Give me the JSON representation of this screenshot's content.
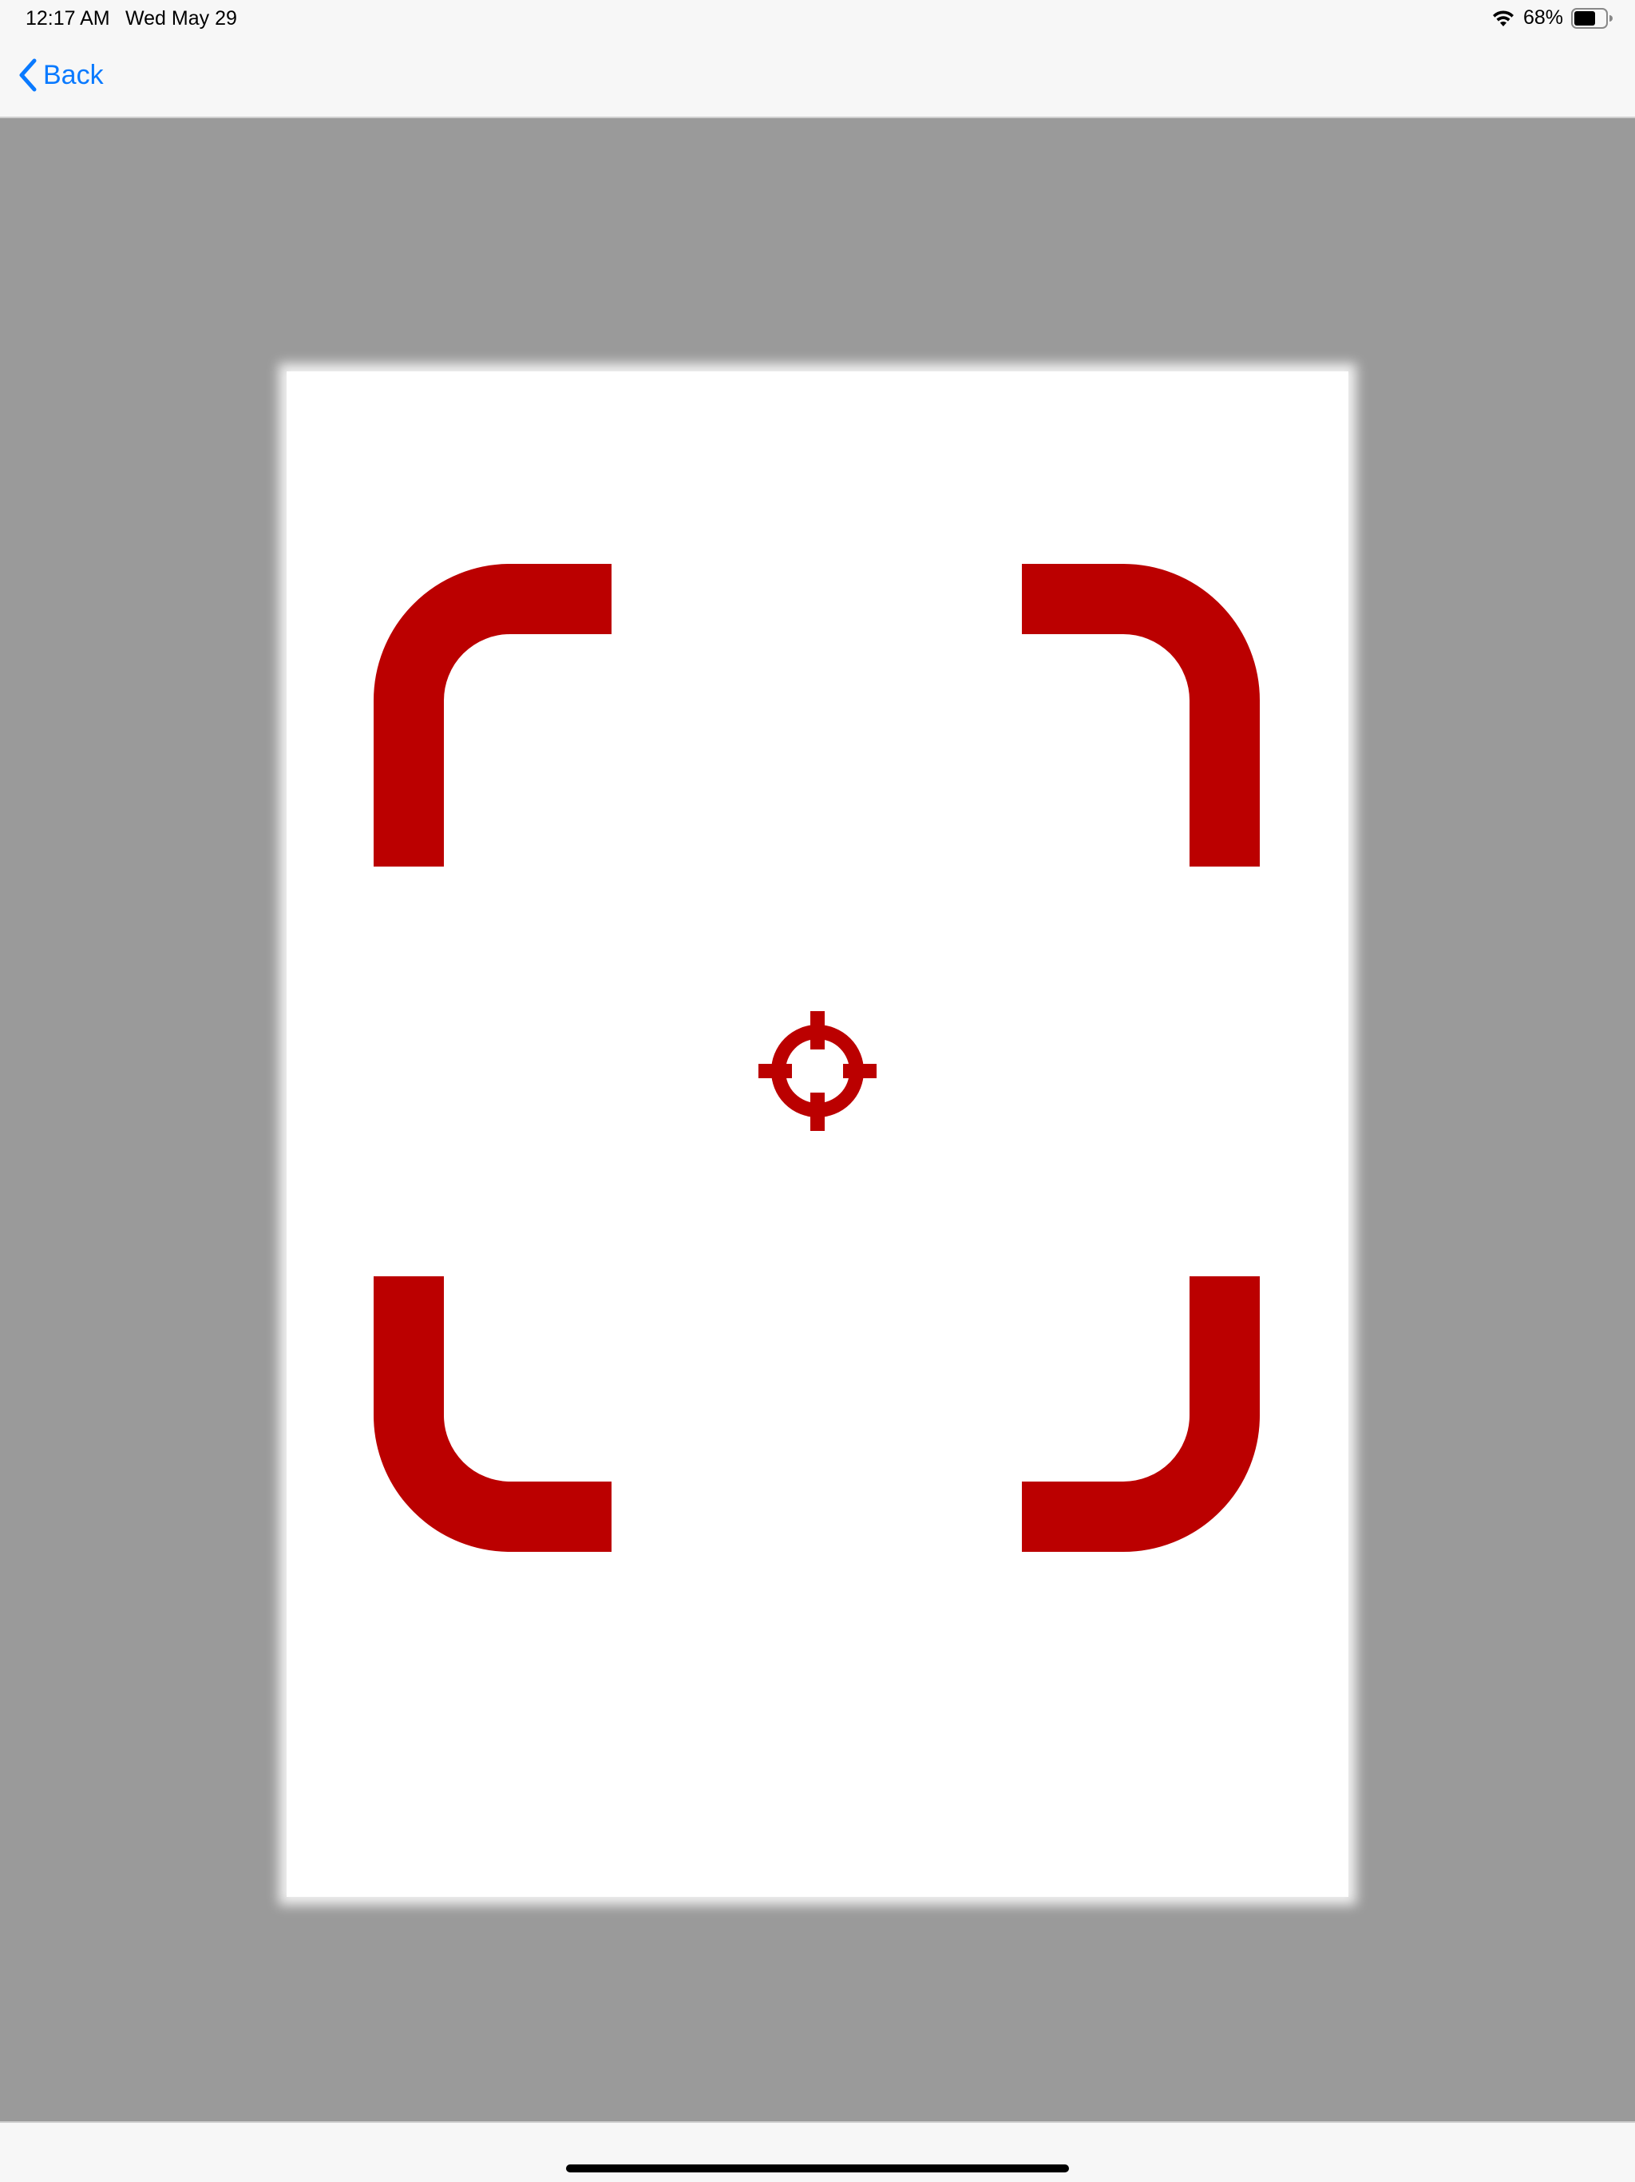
{
  "status_bar": {
    "time": "12:17 AM",
    "date": "Wed May 29",
    "battery_percent": "68%",
    "battery_level": 0.68,
    "wifi_icon": "wifi-icon",
    "battery_icon": "battery-icon"
  },
  "nav_bar": {
    "back_label": "Back",
    "back_icon": "chevron-left-icon"
  },
  "scanner": {
    "frame_icon": "scan-frame-corners",
    "reticle_icon": "crosshair-icon"
  },
  "colors": {
    "accent": "#0a7aff",
    "scan_red": "#bb0000",
    "background_gray": "#9a9a9a",
    "card": "#ffffff"
  }
}
